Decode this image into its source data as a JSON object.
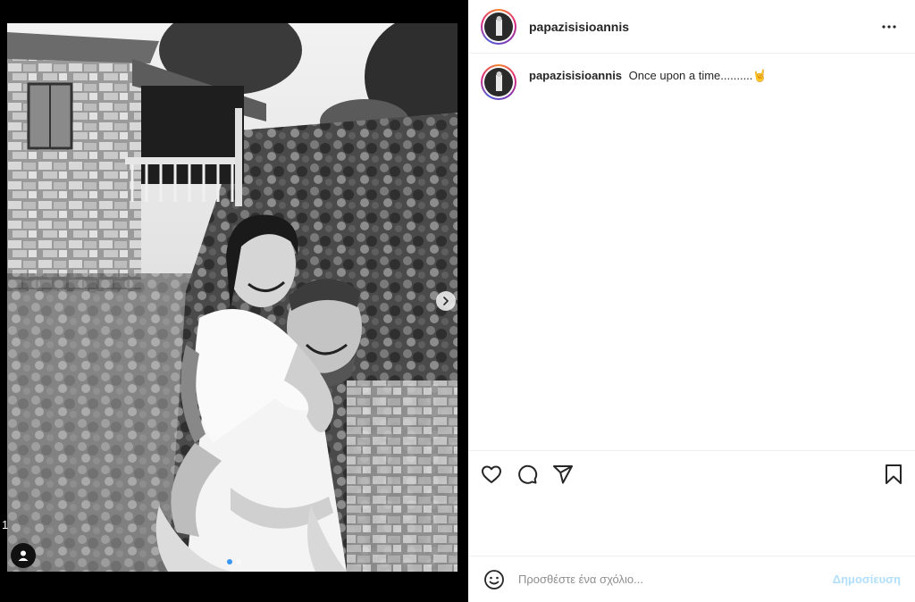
{
  "post": {
    "username": "papazisisioannis",
    "caption_text": "Once upon a time..........",
    "caption_emoji": "🤘",
    "photo_alt": "",
    "side_number": "1",
    "carousel_count": 2,
    "carousel_active": 0
  },
  "icons": {
    "more": "more-options-icon",
    "like": "heart-icon",
    "comment": "comment-bubble-icon",
    "share": "paper-plane-icon",
    "save": "bookmark-icon",
    "emoji": "smiley-icon",
    "next": "chevron-right-icon",
    "user_tag": "user-icon"
  },
  "comment": {
    "placeholder": "Προσθέστε ένα σχόλιο...",
    "post_label": "Δημοσίευση"
  },
  "colors": {
    "post_button_disabled": "#b2dffc",
    "carousel_active_dot": "#3897f0",
    "text_primary": "#262626",
    "text_secondary": "#8e8e8e"
  }
}
